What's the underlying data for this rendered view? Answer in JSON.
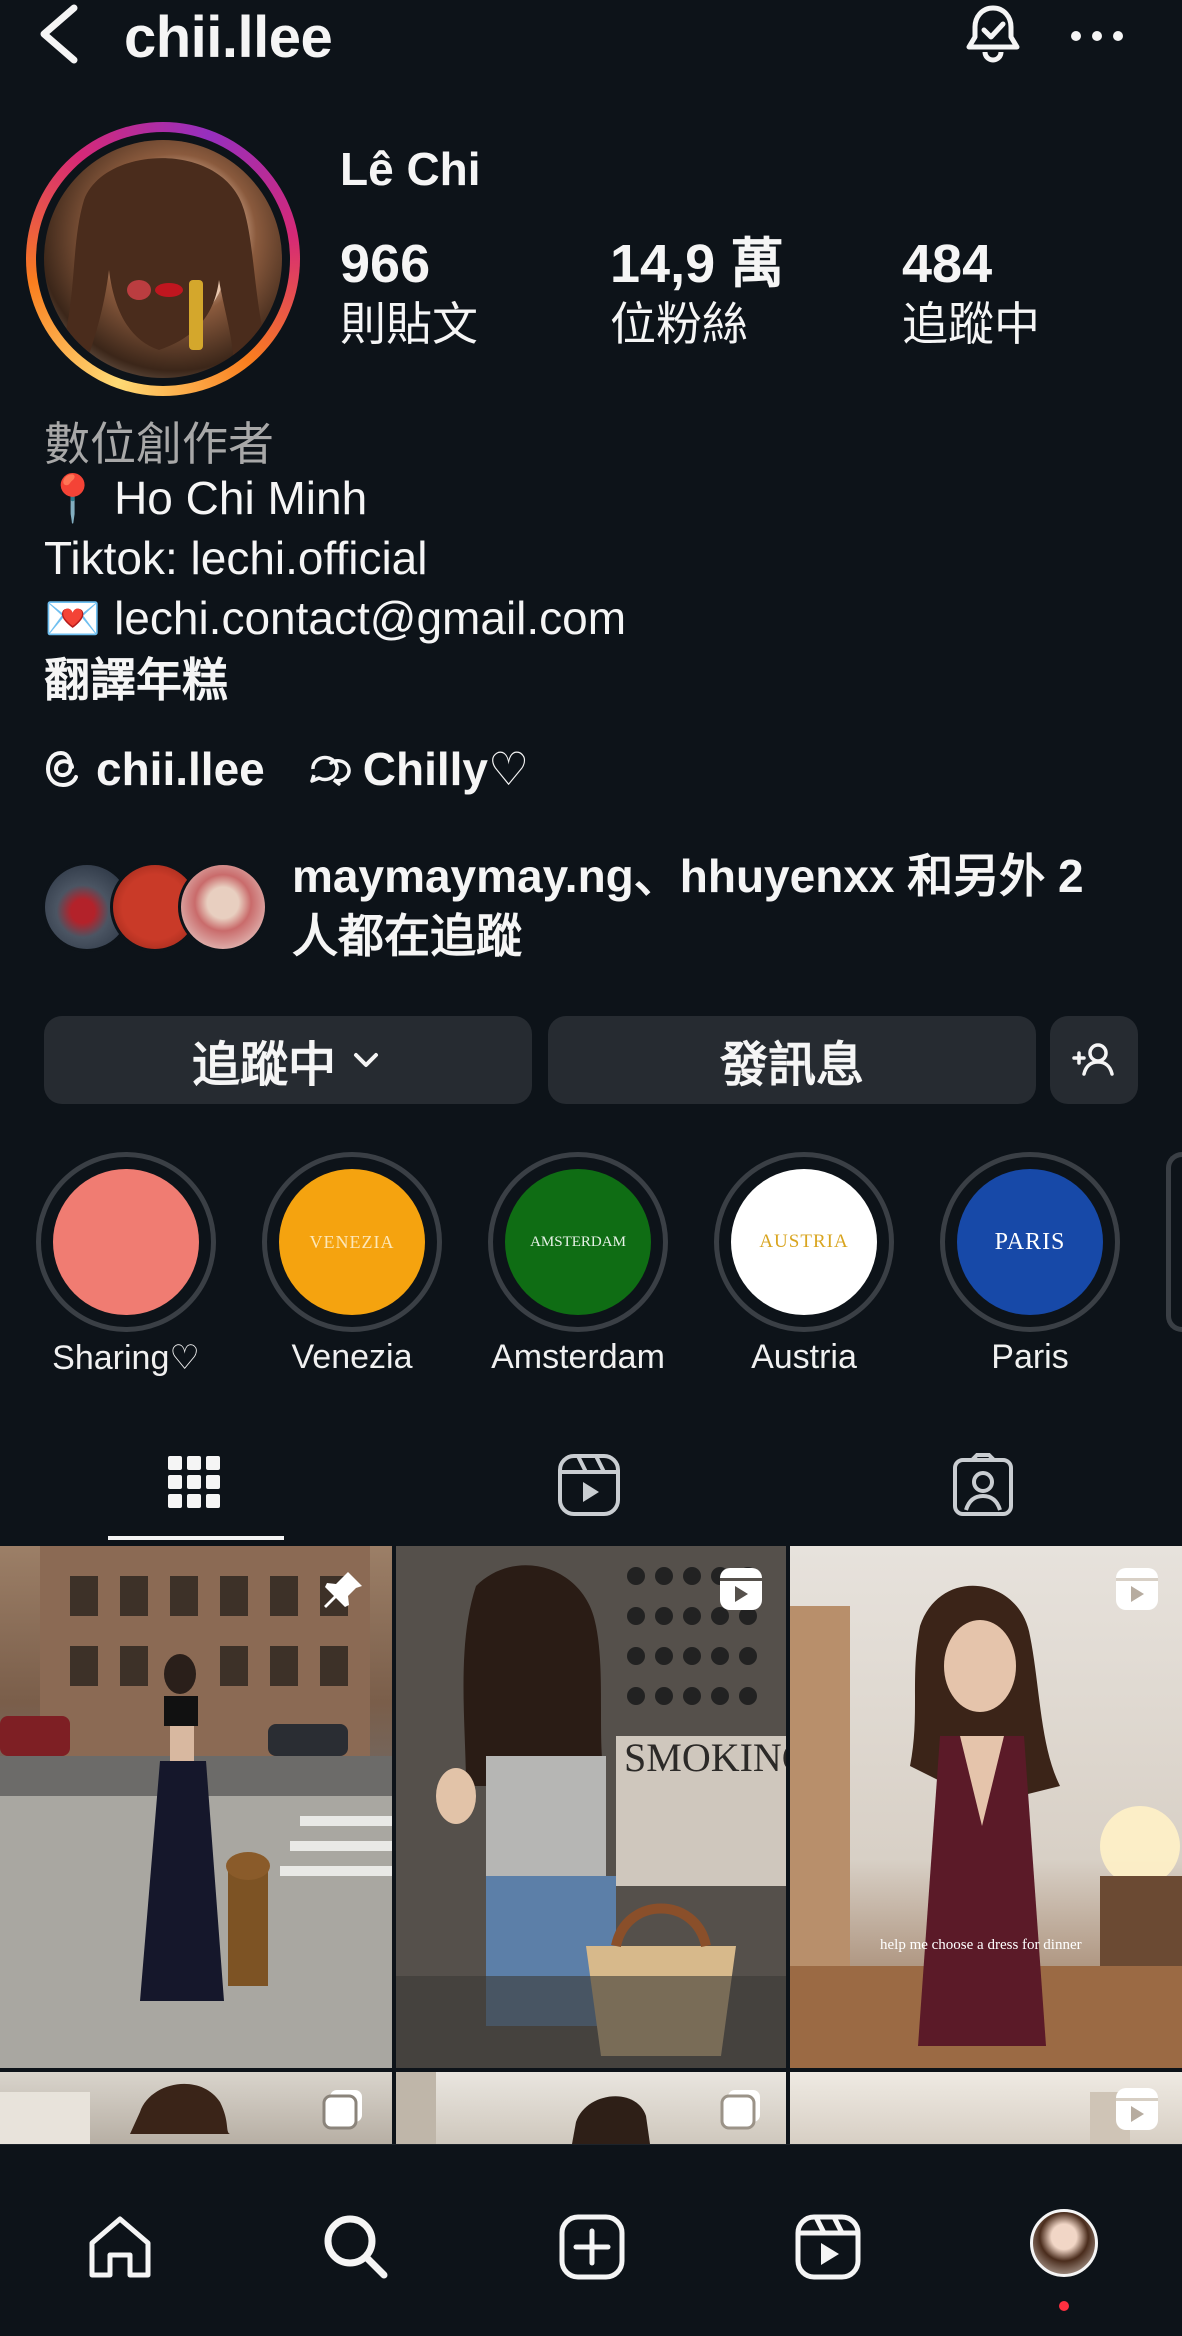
{
  "header": {
    "username": "chii.llee",
    "icons": [
      "back-icon",
      "notification-bell-icon",
      "more-icon"
    ]
  },
  "profile": {
    "display_name": "Lê Chi",
    "stats": [
      {
        "value": "966",
        "label": "則貼文"
      },
      {
        "value": "14,9 萬",
        "label": "位粉絲"
      },
      {
        "value": "484",
        "label": "追蹤中"
      }
    ]
  },
  "bio": {
    "category": "數位創作者",
    "location_emoji": "📍",
    "location": "Ho Chi Minh",
    "tiktok": "Tiktok: lechi.official",
    "email_emoji": "💌",
    "email": "lechi.contact@gmail.com",
    "translate": "翻譯年糕"
  },
  "links": {
    "threads": "chii.llee",
    "channel": "Chilly♡"
  },
  "followed_by": {
    "text": "maymaymay.ng、hhuyenxx 和另外 2 人都在追蹤"
  },
  "buttons": {
    "following": "追蹤中",
    "message": "發訊息"
  },
  "highlights": [
    {
      "label": "Sharing♡",
      "cover_text": "",
      "color": "#f07c72"
    },
    {
      "label": "Venezia",
      "cover_text": "VENEZIA",
      "color": "#f5a30f"
    },
    {
      "label": "Amsterdam",
      "cover_text": "AMSTERDAM",
      "color": "#0f6d14"
    },
    {
      "label": "Austria",
      "cover_text": "AUSTRIA",
      "color": "#ffffff"
    },
    {
      "label": "Paris",
      "cover_text": "PARIS",
      "color": "#1749a8"
    }
  ],
  "posts": {
    "caption_3": "help me choose a dress for dinner",
    "storefront_text": "SMOKING"
  },
  "colors": {
    "background": "#0d1319",
    "button": "#262b31",
    "notification_dot": "#ff3040"
  }
}
